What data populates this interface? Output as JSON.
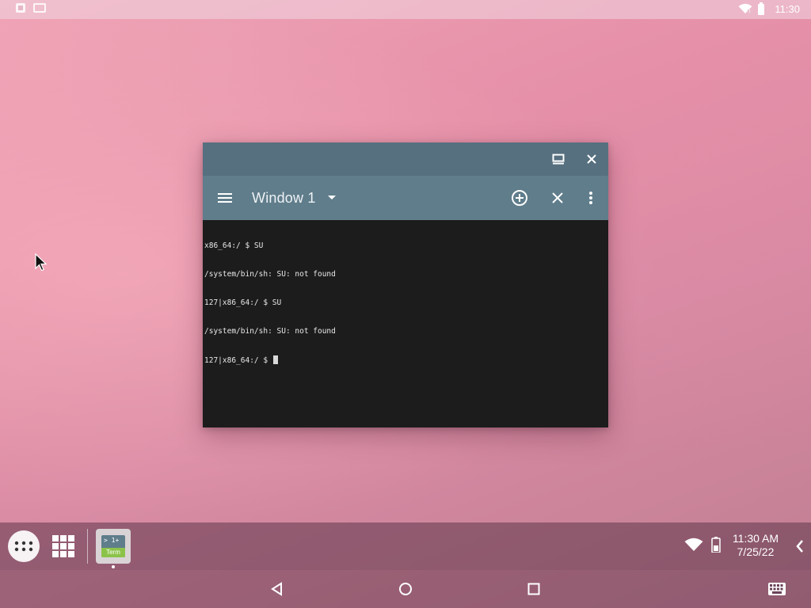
{
  "status_bar": {
    "time": "11:30",
    "icons": [
      "notification-icon",
      "screenshot-icon",
      "wifi-icon",
      "battery-icon"
    ]
  },
  "terminal_window": {
    "tab_name": "Window 1",
    "icons": [
      "maximize-icon",
      "close-icon",
      "menu-icon",
      "dropdown-arrow-icon",
      "add-window-icon",
      "close-window-icon",
      "more-vert-icon"
    ],
    "lines": [
      "x86_64:/ $ SU",
      "/system/bin/sh: SU: not found",
      "127|x86_64:/ $ SU",
      "/system/bin/sh: SU: not found",
      "127|x86_64:/ $ "
    ]
  },
  "taskbar": {
    "app_icon_top": "> 1+",
    "app_icon_bottom": "Term",
    "clock_time": "11:30 AM",
    "clock_date": "7/25/22",
    "icons": [
      "app-drawer-icon",
      "recents-grid-icon",
      "wifi-icon",
      "battery-icon",
      "chevron-left-icon"
    ]
  },
  "nav_bar": {
    "icons": [
      "back-icon",
      "home-icon",
      "overview-icon",
      "keyboard-icon"
    ]
  },
  "colors": {
    "window_titlebar": "#56707f",
    "app_toolbar": "#607d8b",
    "terminal_bg": "#1c1c1c",
    "terminal_text": "#e8e8e8"
  }
}
